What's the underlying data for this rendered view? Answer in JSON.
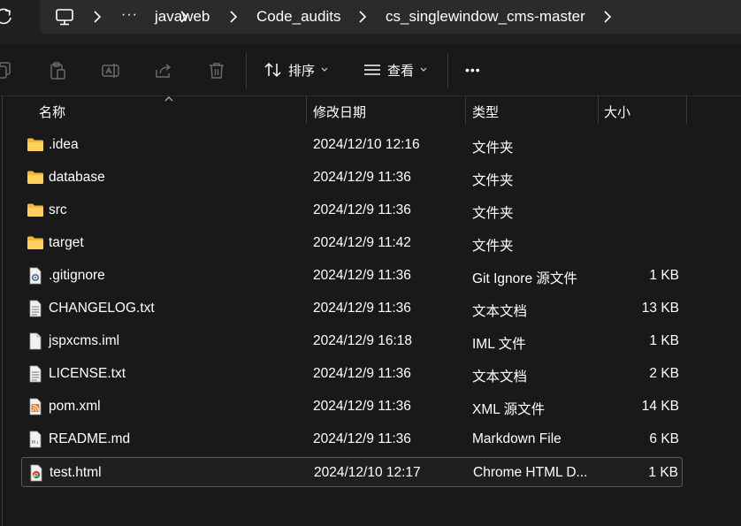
{
  "breadcrumb": {
    "overflow": "···",
    "items": [
      "javaweb",
      "Code_audits",
      "cs_singlewindow_cms-master"
    ]
  },
  "toolbar": {
    "sort_label": "排序",
    "view_label": "查看",
    "more_label": "•••"
  },
  "columns": {
    "name": "名称",
    "date": "修改日期",
    "type": "类型",
    "size": "大小"
  },
  "files": [
    {
      "name": ".idea",
      "date": "2024/12/10 12:16",
      "type": "文件夹",
      "size": "",
      "icon": "folder-icon"
    },
    {
      "name": "database",
      "date": "2024/12/9 11:36",
      "type": "文件夹",
      "size": "",
      "icon": "folder-icon"
    },
    {
      "name": "src",
      "date": "2024/12/9 11:36",
      "type": "文件夹",
      "size": "",
      "icon": "folder-icon"
    },
    {
      "name": "target",
      "date": "2024/12/9 11:42",
      "type": "文件夹",
      "size": "",
      "icon": "folder-icon"
    },
    {
      "name": ".gitignore",
      "date": "2024/12/9 11:36",
      "type": "Git Ignore 源文件",
      "size": "1 KB",
      "icon": "gear-file-icon"
    },
    {
      "name": "CHANGELOG.txt",
      "date": "2024/12/9 11:36",
      "type": "文本文档",
      "size": "13 KB",
      "icon": "text-file-icon"
    },
    {
      "name": "jspxcms.iml",
      "date": "2024/12/9 16:18",
      "type": "IML 文件",
      "size": "1 KB",
      "icon": "blank-file-icon"
    },
    {
      "name": "LICENSE.txt",
      "date": "2024/12/9 11:36",
      "type": "文本文档",
      "size": "2 KB",
      "icon": "text-file-icon"
    },
    {
      "name": "pom.xml",
      "date": "2024/12/9 11:36",
      "type": "XML 源文件",
      "size": "14 KB",
      "icon": "rss-file-icon"
    },
    {
      "name": "README.md",
      "date": "2024/12/9 11:36",
      "type": "Markdown File",
      "size": "6 KB",
      "icon": "markdown-file-icon"
    },
    {
      "name": "test.html",
      "date": "2024/12/10 12:17",
      "type": "Chrome HTML D...",
      "size": "1 KB",
      "icon": "chrome-file-icon",
      "selected": true
    }
  ]
}
